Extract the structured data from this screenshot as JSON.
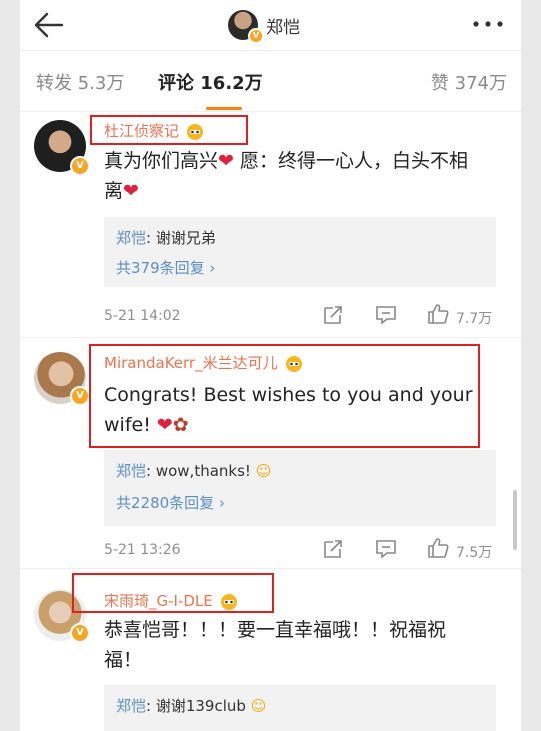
{
  "header": {
    "title": "郑恺",
    "back_icon": "arrow-left-icon",
    "more_icon": "more-dots-icon"
  },
  "tabs": {
    "repost": "转发 5.3万",
    "comment": "评论 16.2万",
    "like": "赞 374万",
    "accent_color": "#ff8200"
  },
  "comments": [
    {
      "user": "杜江侦察记",
      "text_part1": "真为你们高兴",
      "text_part2": " 愿：终得一心人，白头不相",
      "text_line2": "离",
      "reply_name": "郑恺",
      "reply_text": ":  谢谢兄弟",
      "reply_more": "共379条回复 ›",
      "time": "5-21 14:02",
      "likes": "7.7万"
    },
    {
      "user": "MirandaKerr_米兰达可儿",
      "text_line1": "Congrats!  Best wishes to you and your",
      "text_line2": "wife! ",
      "reply_name": "郑恺",
      "reply_text": ":  wow,thanks!",
      "reply_more": "共2280条回复 ›",
      "time": "5-21 13:26",
      "likes": "7.5万"
    },
    {
      "user": "宋雨琦_G-I-DLE",
      "text_line1": "恭喜恺哥！！！要一直幸福哦！！祝福祝",
      "text_line2": "福！",
      "reply_name": "郑恺",
      "reply_text": ":  谢谢139club"
    }
  ],
  "colors": {
    "username": "#eb7350",
    "reply_name": "#5b8ec6",
    "highlight_box": "#e02020"
  }
}
